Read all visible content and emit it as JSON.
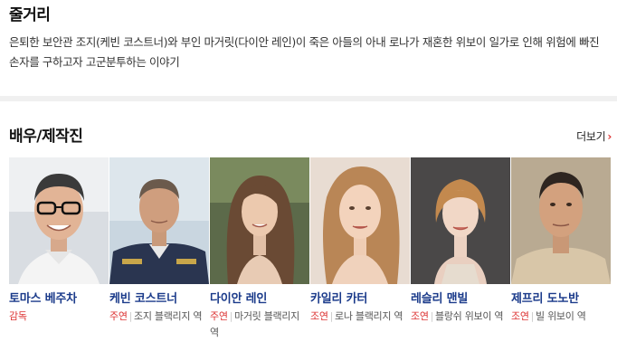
{
  "synopsis": {
    "title": "줄거리",
    "text": "은퇴한 보안관 조지(케빈 코스트너)와 부인 마거릿(다이안 레인)이 죽은 아들의 아내 로나가 재혼한 위보이 일가로 인해 위험에 빠진 손자를 구하고자 고군분투하는 이야기"
  },
  "cast": {
    "title": "배우/제작진",
    "more_label": "더보기",
    "members": [
      {
        "name": "토마스 베주차",
        "role_type": "감독",
        "role": ""
      },
      {
        "name": "케빈 코스트너",
        "role_type": "주연",
        "role": "조지 블랙리지 역"
      },
      {
        "name": "다이안 레인",
        "role_type": "주연",
        "role": "마거릿 블랙리지 역"
      },
      {
        "name": "카일리 카터",
        "role_type": "조연",
        "role": "로나 블랙리지 역"
      },
      {
        "name": "레슬리 맨빌",
        "role_type": "조연",
        "role": "블랑쉬 위보이 역"
      },
      {
        "name": "제프리 도노반",
        "role_type": "조연",
        "role": "빌 위보이 역"
      }
    ]
  },
  "colors": {
    "accent": "#dd3333",
    "name": "#1a3a8a"
  }
}
